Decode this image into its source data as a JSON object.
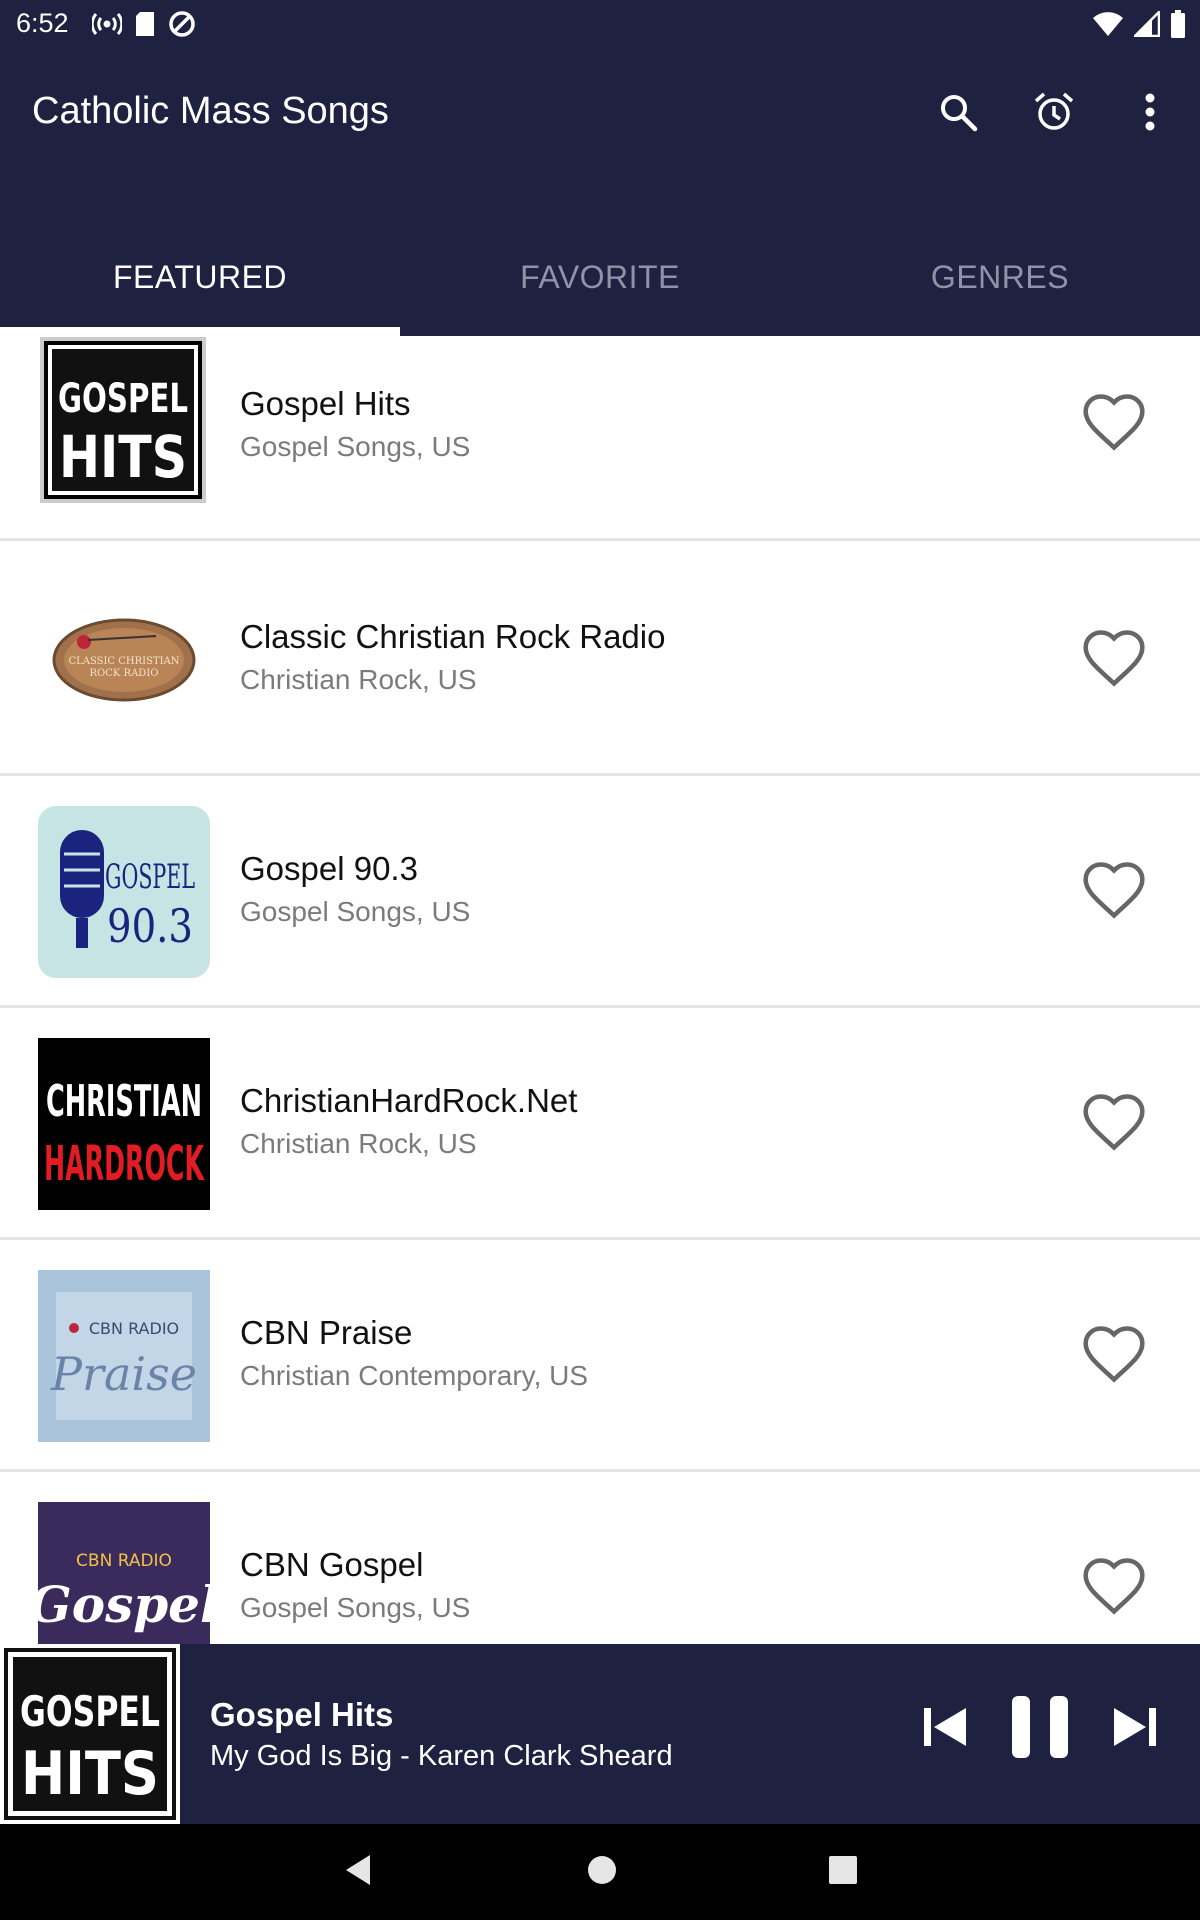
{
  "status_bar": {
    "time": "6:52"
  },
  "app_bar": {
    "title": "Catholic Mass Songs",
    "actions": [
      "search-icon",
      "alarm-icon",
      "more-vert-icon"
    ]
  },
  "tabs": [
    {
      "label": "FEATURED",
      "active": true
    },
    {
      "label": "FAVORITE",
      "active": false
    },
    {
      "label": "GENRES",
      "active": false
    }
  ],
  "stations": [
    {
      "name": "Gospel Hits",
      "genre": "Gospel Songs, US",
      "logo": {
        "line1": "GOSPEL",
        "line2": "HITS"
      }
    },
    {
      "name": "Classic Christian Rock Radio",
      "genre": "Christian Rock, US",
      "logo": {
        "line1": "CLASSIC CHRISTIAN",
        "line2": "ROCK RADIO"
      }
    },
    {
      "name": "Gospel 90.3",
      "genre": "Gospel Songs, US",
      "logo": {
        "line1": "GOSPEL",
        "line2": "90.3"
      }
    },
    {
      "name": "ChristianHardRock.Net",
      "genre": "Christian Rock, US",
      "logo": {
        "line1": "CHRISTIAN",
        "line2": "HARDROCK"
      }
    },
    {
      "name": "CBN Praise",
      "genre": "Christian Contemporary, US",
      "logo": {
        "line1": "CBN RADIO",
        "line2": "Praise"
      }
    },
    {
      "name": "CBN Gospel",
      "genre": "Gospel Songs, US",
      "logo": {
        "line1": "CBN RADIO",
        "line2": "Gospel"
      }
    }
  ],
  "now_playing": {
    "station": "Gospel Hits",
    "track": "My God Is Big - Karen Clark Sheard",
    "logo": {
      "line1": "GOSPEL",
      "line2": "HITS"
    }
  },
  "colors": {
    "primary": "#1e2140",
    "tab_inactive": "#8f93a7",
    "divider": "#e4e4e4"
  }
}
